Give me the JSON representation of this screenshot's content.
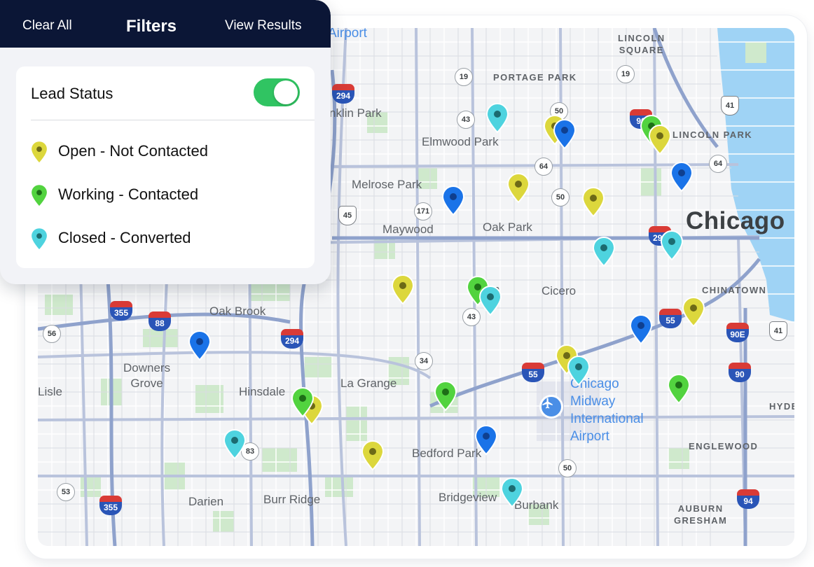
{
  "panel": {
    "clear_all": "Clear All",
    "title": "Filters",
    "view_results": "View Results",
    "lead_status_label": "Lead Status",
    "lead_status_enabled": true,
    "legend": [
      {
        "label": "Open - Not Contacted",
        "color": "#dcd73c",
        "dot": "#6d6a17"
      },
      {
        "label": "Working - Contacted",
        "color": "#52d33f",
        "dot": "#1d6f17"
      },
      {
        "label": "Closed - Converted",
        "color": "#4ed3df",
        "dot": "#1c6b70"
      }
    ]
  },
  "map": {
    "places": {
      "airport_top": "Airport",
      "lincoln_square": "LINCOLN\nSQUARE",
      "portage_park": "PORTAGE PARK",
      "franklin_park": "nklin Park",
      "elmwood_park": "Elmwood Park",
      "lincoln_park": "LINCOLN PARK",
      "melrose_park": "Melrose Park",
      "maywood": "Maywood",
      "oak_park": "Oak Park",
      "chicago": "Chicago",
      "cicero": "Cicero",
      "chinatown": "CHINATOWN",
      "oak_brook": "Oak Brook",
      "downers_grove": "Downers\nGrove",
      "lisle": "Lisle",
      "hinsdale": "Hinsdale",
      "la_grange": "La Grange",
      "midway": "Chicago\nMidway\nInternational\nAirport",
      "hyde": "HYDE",
      "bedford_park": "Bedford Park",
      "englewood": "ENGLEWOOD",
      "darien": "Darien",
      "burr_ridge": "Burr Ridge",
      "bridgeview": "Bridgeview",
      "burbank": "Burbank",
      "auburn_gresham": "AUBURN\nGRESHAM",
      "berwyn_partial": "n"
    },
    "route_shields": [
      "19",
      "19",
      "50",
      "43",
      "64",
      "64",
      "50",
      "171",
      "43",
      "34",
      "83",
      "53",
      "56",
      "50"
    ],
    "interstate_shields": [
      "294",
      "355",
      "88",
      "294",
      "55",
      "55",
      "290",
      "90E",
      "90",
      "94",
      "355",
      "90"
    ],
    "us_shields": [
      "41",
      "45",
      "41"
    ],
    "pin_colors": {
      "open": "#dcd73c",
      "working": "#52d33f",
      "closed": "#4ed3df",
      "other": "#1a73e8"
    }
  }
}
